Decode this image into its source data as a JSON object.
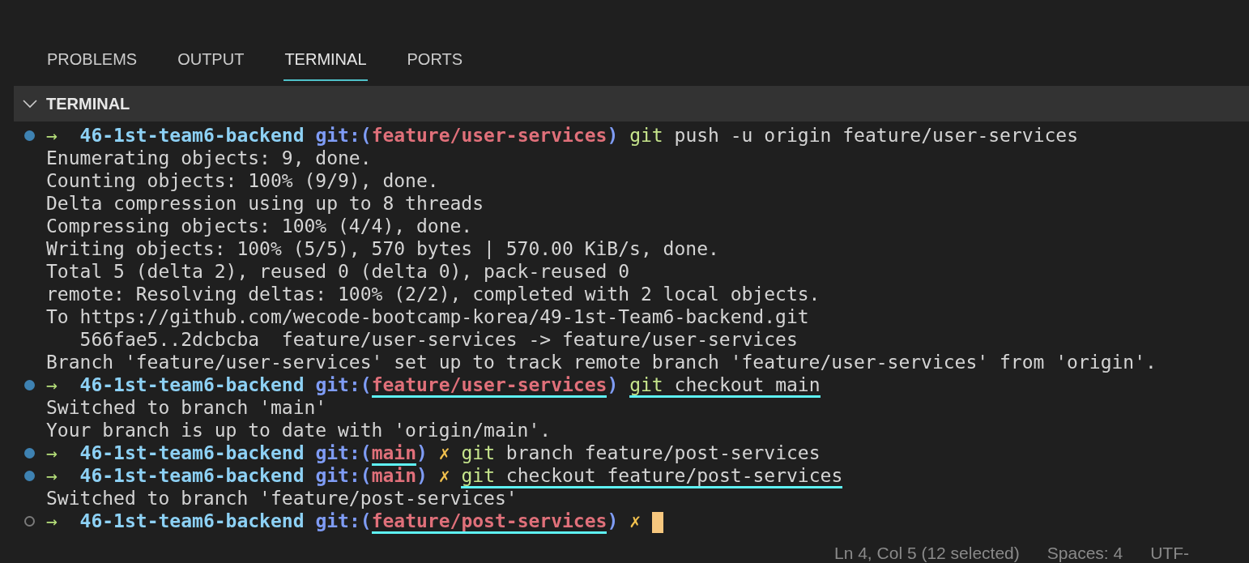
{
  "tabs": [
    {
      "label": "PROBLEMS",
      "selected": false
    },
    {
      "label": "OUTPUT",
      "selected": false
    },
    {
      "label": "TERMINAL",
      "selected": true
    },
    {
      "label": "PORTS",
      "selected": false
    }
  ],
  "panel": {
    "title": "TERMINAL",
    "expanded": true
  },
  "terminal_lines": [
    {
      "kind": "prompt",
      "finished": true,
      "arrow": "→",
      "directory": "46-1st-team6-backend",
      "git_open": "git:(",
      "branch": "feature/user-services",
      "git_close": ")",
      "program": "git",
      "args": "push -u origin feature/user-services"
    },
    {
      "kind": "output",
      "text": "Enumerating objects: 9, done."
    },
    {
      "kind": "output",
      "text": "Counting objects: 100% (9/9), done."
    },
    {
      "kind": "output",
      "text": "Delta compression using up to 8 threads"
    },
    {
      "kind": "output",
      "text": "Compressing objects: 100% (4/4), done."
    },
    {
      "kind": "output",
      "text": "Writing objects: 100% (5/5), 570 bytes | 570.00 KiB/s, done."
    },
    {
      "kind": "output",
      "text": "Total 5 (delta 2), reused 0 (delta 0), pack-reused 0"
    },
    {
      "kind": "output",
      "text": "remote: Resolving deltas: 100% (2/2), completed with 2 local objects."
    },
    {
      "kind": "output",
      "text": "To https://github.com/wecode-bootcamp-korea/49-1st-Team6-backend.git"
    },
    {
      "kind": "output",
      "text": "   566fae5..2dcbcba  feature/user-services -> feature/user-services"
    },
    {
      "kind": "output",
      "text": "Branch 'feature/user-services' set up to track remote branch 'feature/user-services' from 'origin'."
    },
    {
      "kind": "prompt",
      "finished": true,
      "arrow": "→",
      "directory": "46-1st-team6-backend",
      "git_open": "git:(",
      "branch": "feature/user-services",
      "git_close": ")",
      "program": "git",
      "args": "checkout main",
      "branch_underlined": true,
      "command_underlined": true
    },
    {
      "kind": "output",
      "text": "Switched to branch 'main'"
    },
    {
      "kind": "output",
      "text": "Your branch is up to date with 'origin/main'."
    },
    {
      "kind": "prompt",
      "finished": true,
      "arrow": "→",
      "directory": "46-1st-team6-backend",
      "git_open": "git:(",
      "branch": "main",
      "git_close": ")",
      "dirty_mark": "✗",
      "program": "git",
      "args": "branch feature/post-services",
      "branch_underlined": true
    },
    {
      "kind": "prompt",
      "finished": true,
      "arrow": "→",
      "directory": "46-1st-team6-backend",
      "git_open": "git:(",
      "branch": "main",
      "git_close": ")",
      "dirty_mark": "✗",
      "program": "git",
      "args": "checkout feature/post-services",
      "command_underlined": true
    },
    {
      "kind": "output",
      "text": "Switched to branch 'feature/post-services'"
    },
    {
      "kind": "prompt",
      "finished": false,
      "arrow": "→",
      "directory": "46-1st-team6-backend",
      "git_open": "git:(",
      "branch": "feature/post-services",
      "git_close": ")",
      "dirty_mark": "✗",
      "branch_underlined": true,
      "cursor": true
    }
  ],
  "status_bar": [
    "Ln 4, Col 5 (12 selected)",
    "Spaces: 4",
    "UTF-"
  ]
}
